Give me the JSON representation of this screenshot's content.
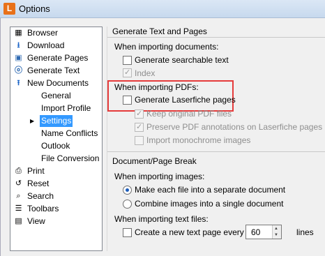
{
  "app": {
    "title": "Options",
    "icon_letter": "L"
  },
  "sidebar": {
    "items": [
      {
        "label": "Browser"
      },
      {
        "label": "Download"
      },
      {
        "label": "Generate Pages"
      },
      {
        "label": "Generate Text"
      },
      {
        "label": "New Documents"
      }
    ],
    "subitems": [
      {
        "label": "General"
      },
      {
        "label": "Import Profile"
      },
      {
        "label": "Settings"
      },
      {
        "label": "Name Conflicts"
      },
      {
        "label": "Outlook"
      },
      {
        "label": "File Conversion"
      }
    ],
    "items2": [
      {
        "label": "Print"
      },
      {
        "label": "Reset"
      },
      {
        "label": "Search"
      },
      {
        "label": "Toolbars"
      },
      {
        "label": "View"
      }
    ]
  },
  "generate": {
    "title": "Generate Text and Pages",
    "importing_documents": "When importing documents:",
    "searchable_text": "Generate searchable text",
    "index": "Index",
    "importing_pdfs": "When importing PDFs:",
    "laserfiche_pages": "Generate Laserfiche pages",
    "keep_original": "Keep original PDF files",
    "preserve_annotations": "Preserve PDF annotations on Laserfiche pages",
    "import_monochrome": "Import monochrome images"
  },
  "pagebreak": {
    "title": "Document/Page Break",
    "importing_images": "When importing images:",
    "separate_document": "Make each file into a separate document",
    "single_document": "Combine images into a single document",
    "importing_text": "When importing text files:",
    "new_text_page": "Create a new text page every",
    "lines_value": "60",
    "lines_unit": "lines"
  },
  "state": {
    "selected_subitem": "Settings",
    "searchable_text": false,
    "index": true,
    "laserfiche_pages": false,
    "keep_original": true,
    "preserve_annotations": true,
    "import_monochrome": false,
    "image_mode": "separate",
    "new_text_page": false
  },
  "colors": {
    "selection": "#3399ff",
    "highlight_border": "#e53b3b",
    "app_icon": "#e8711a"
  }
}
